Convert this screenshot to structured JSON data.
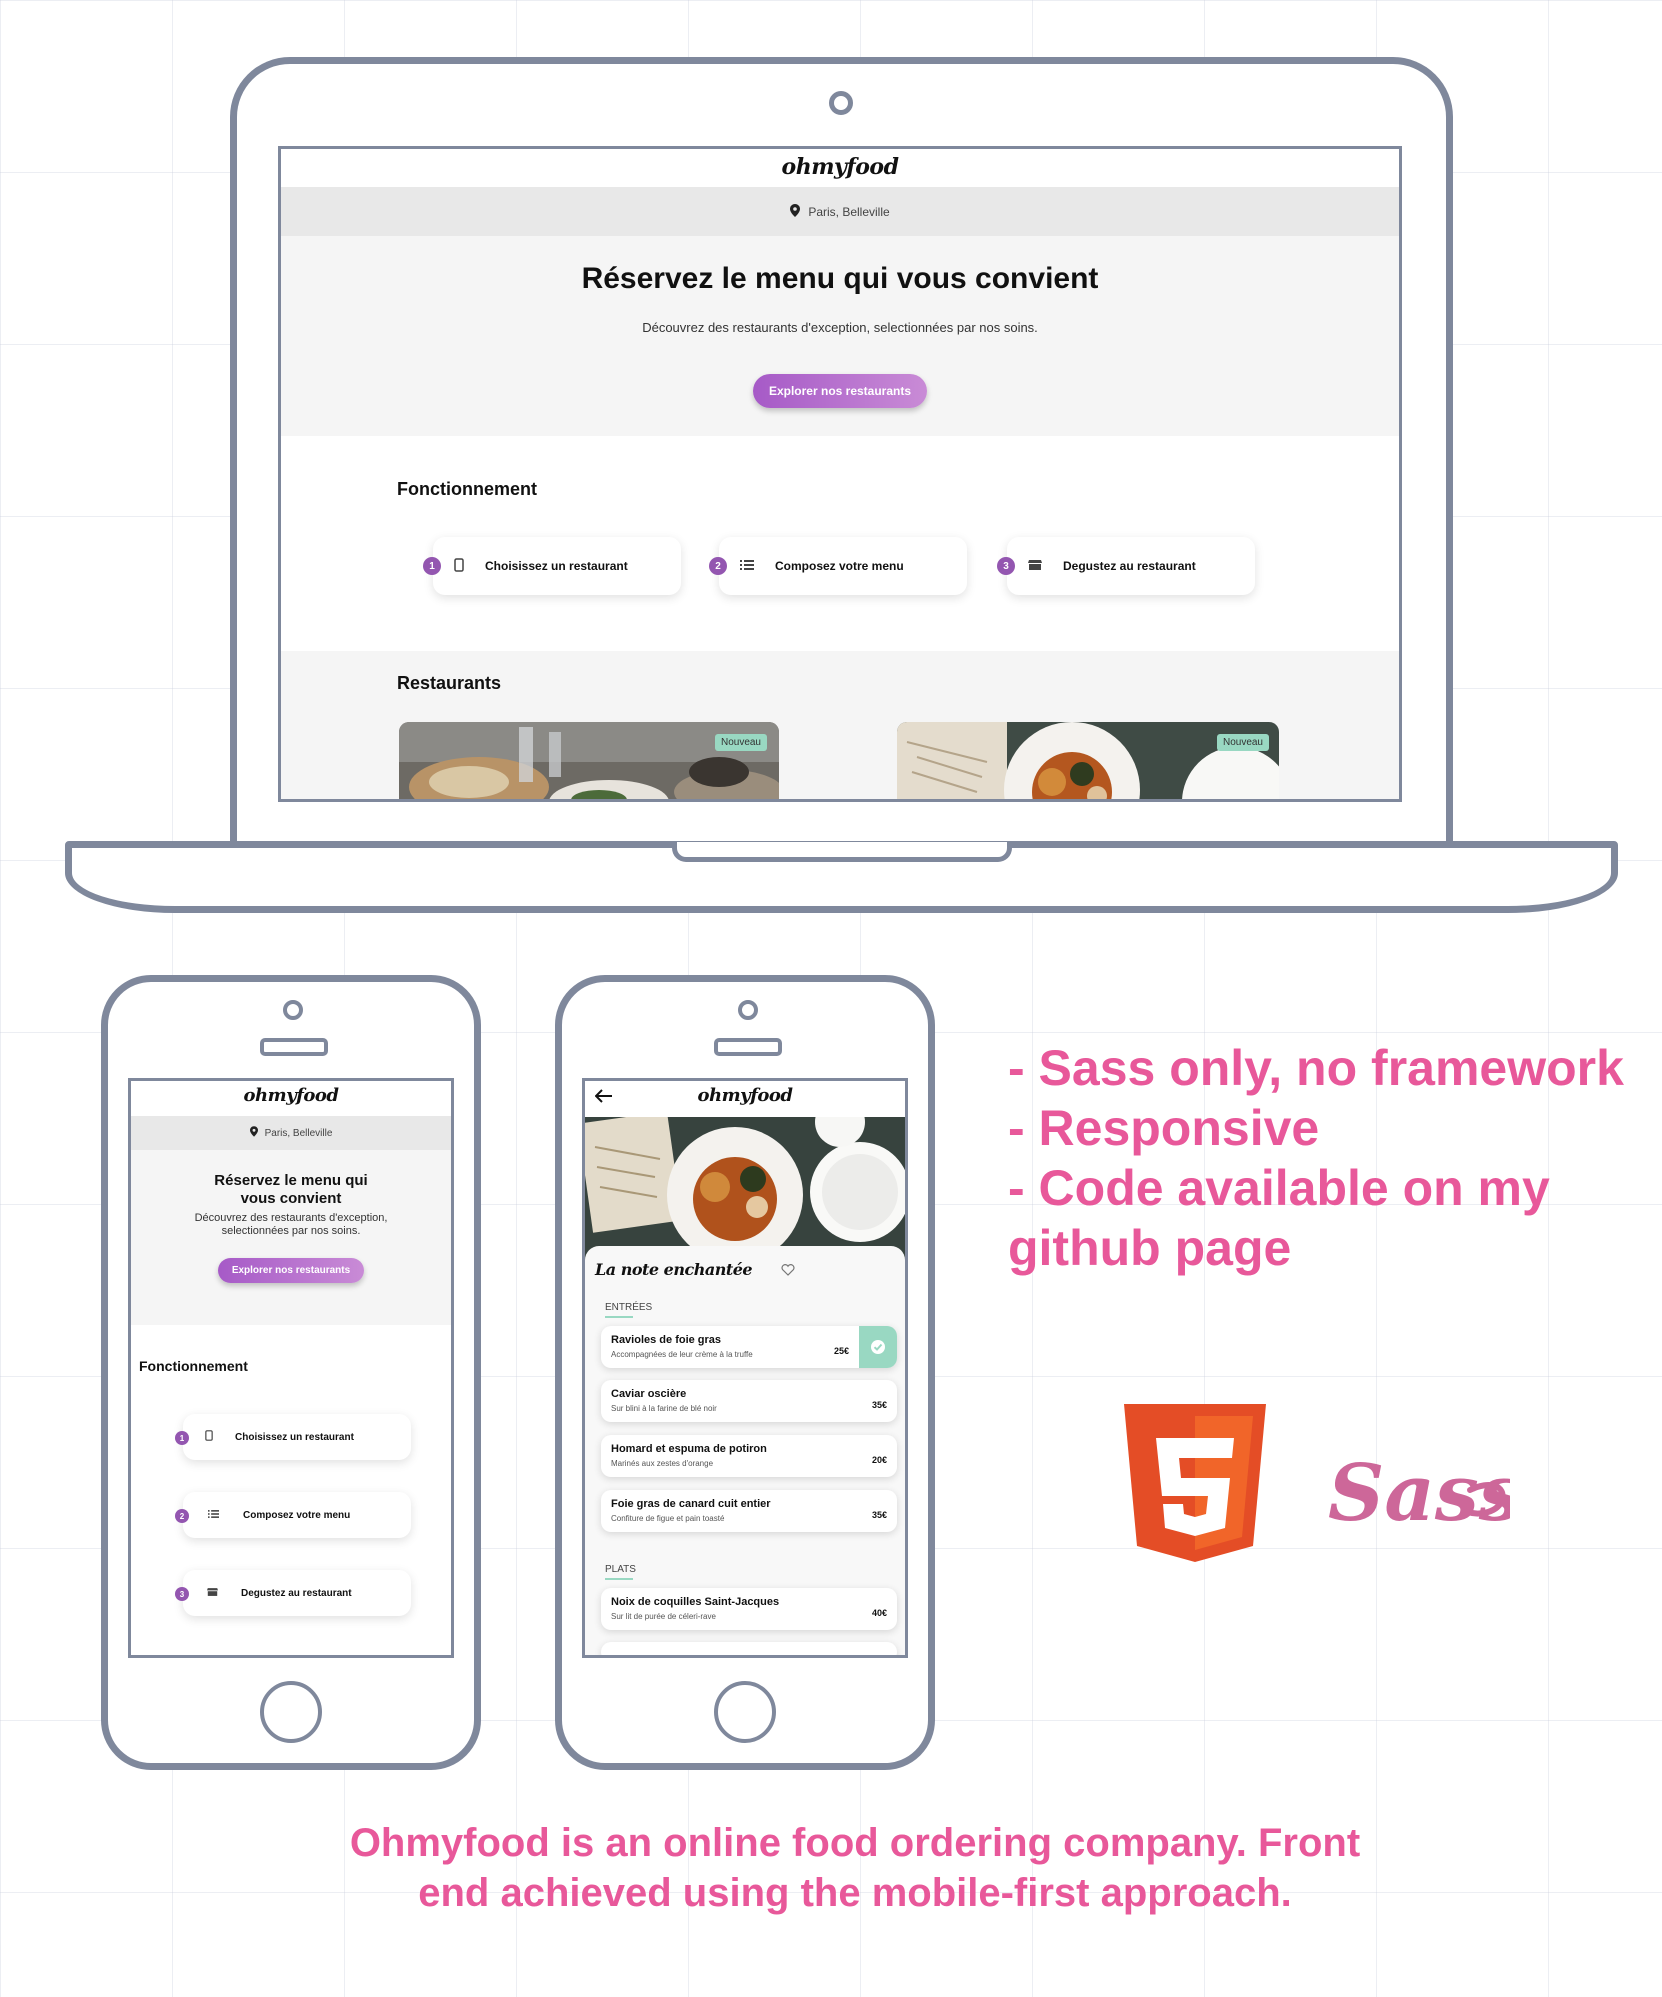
{
  "site": {
    "logo": "ohmyfood",
    "location": "Paris, Belleville",
    "hero": {
      "title": "Réservez le menu qui vous convient",
      "subtitle": "Découvrez des restaurants d'exception, selectionnées par nos soins.",
      "cta": "Explorer nos restaurants"
    },
    "how_title": "Fonctionnement",
    "steps": [
      {
        "num": "1",
        "label": "Choisissez un restaurant",
        "icon": "phone-icon"
      },
      {
        "num": "2",
        "label": "Composez votre menu",
        "icon": "list-icon"
      },
      {
        "num": "3",
        "label": "Degustez au restaurant",
        "icon": "store-icon"
      }
    ],
    "restaurants_title": "Restaurants",
    "badge": "Nouveau"
  },
  "mobile_home": {
    "hero_title_line1": "Réservez le menu qui",
    "hero_title_line2": "vous convient",
    "subtitle_line1": "Découvrez des restaurants d'exception,",
    "subtitle_line2": "selectionnées par nos soins."
  },
  "menu_page": {
    "restaurant_name": "La note enchantée",
    "sections": [
      {
        "title": "ENTRÉES",
        "items": [
          {
            "name": "Ravioles de foie gras",
            "desc": "Accompagnées de leur crème à la truffe",
            "price": "25€",
            "checked": true
          },
          {
            "name": "Caviar oscière",
            "desc": "Sur blini à la farine de blé noir",
            "price": "35€"
          },
          {
            "name": "Homard et espuma de potiron",
            "desc": "Marinés aux zestes d'orange",
            "price": "20€"
          },
          {
            "name": "Foie gras de canard cuit entier",
            "desc": "Confiture de figue et pain toasté",
            "price": "35€"
          }
        ]
      },
      {
        "title": "PLATS",
        "items": [
          {
            "name": "Noix de coquilles Saint-Jacques",
            "desc": "Sur lit de purée de céleri-rave",
            "price": "40€"
          }
        ]
      }
    ]
  },
  "bullets": [
    "- Sass only, no framework",
    "- Responsive",
    "- Code available on my",
    "github page"
  ],
  "logos": {
    "html5_glyph": "5",
    "sass_text": "Sass"
  },
  "footer": {
    "line1": "Ohmyfood is an online food ordering company. Front",
    "line2": "end achieved using the mobile-first approach."
  },
  "colors": {
    "accent_pink": "#e8589a",
    "purple": "#9356b0",
    "mint": "#99d8c2",
    "device_stroke": "#7f889c",
    "html5_orange": "#e44d26",
    "sass_pink": "#cd6799"
  }
}
